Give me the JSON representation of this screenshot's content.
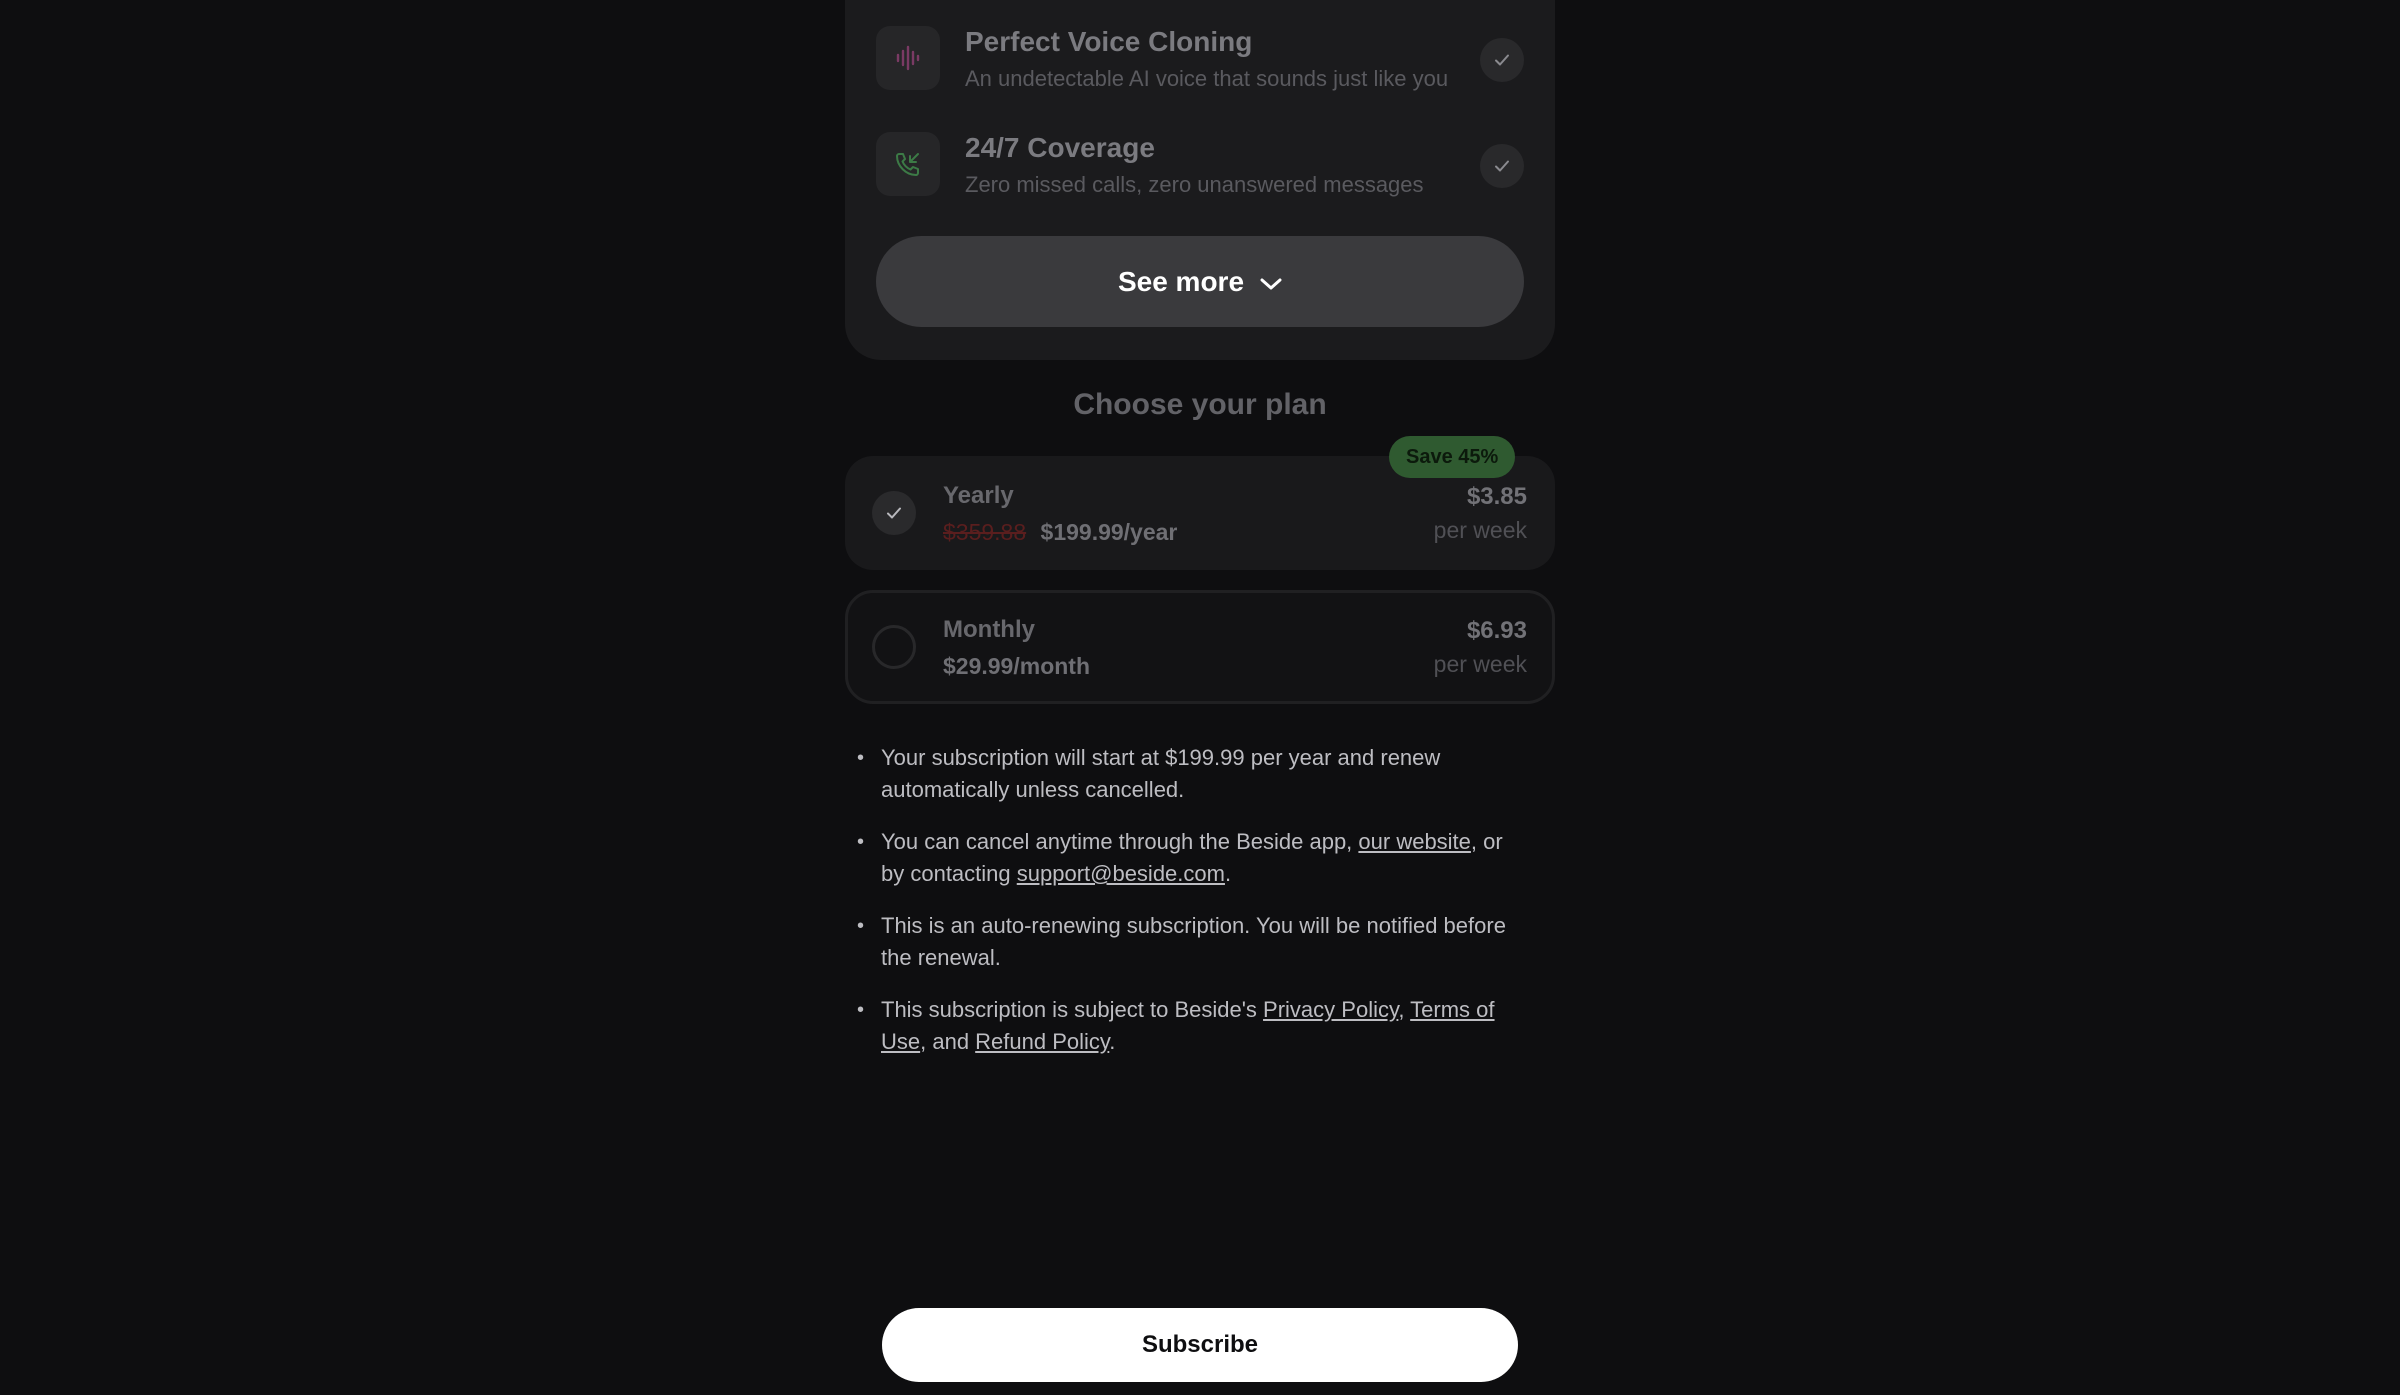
{
  "features": [
    {
      "title": "Perfect Voice Cloning",
      "description": "An undetectable AI voice that sounds just like you",
      "icon": "waveform-icon",
      "icon_color": "#8a3a6a"
    },
    {
      "title": "24/7 Coverage",
      "description": "Zero missed calls, zero unanswered messages",
      "icon": "incoming-call-icon",
      "icon_color": "#3a7a44"
    }
  ],
  "see_more": {
    "label": "See more"
  },
  "plans": {
    "heading": "Choose your plan",
    "yearly": {
      "badge": "Save 45%",
      "name": "Yearly",
      "old_price": "$359.88",
      "price_text": "$199.99/year",
      "weekly_price": "$3.85",
      "per_label": "per week",
      "selected": true
    },
    "monthly": {
      "name": "Monthly",
      "price_text": "$29.99/month",
      "weekly_price": "$6.93",
      "per_label": "per week",
      "selected": false
    }
  },
  "terms": {
    "item1": "Your subscription will start at $199.99 per year and renew automatically unless cancelled.",
    "item2_prefix": "You can cancel anytime through the Beside app, ",
    "item2_link1": "our website",
    "item2_middle": ", or by contacting ",
    "item2_link2": "support@beside.com",
    "item2_suffix": ".",
    "item3": "This is an auto-renewing subscription. You will be notified before the renewal.",
    "item4_prefix": "This subscription is subject to Beside's ",
    "item4_link1": "Privacy Policy",
    "item4_sep1": ", ",
    "item4_link2": "Terms of Use",
    "item4_sep2": ", and ",
    "item4_link3": "Refund Policy",
    "item4_suffix": "."
  },
  "subscribe": {
    "label": "Subscribe"
  },
  "colors": {
    "background": "#0e0e10",
    "card": "#1b1b1d",
    "badge_green": "#2f5a30",
    "strike_red": "#5a1e1e"
  }
}
